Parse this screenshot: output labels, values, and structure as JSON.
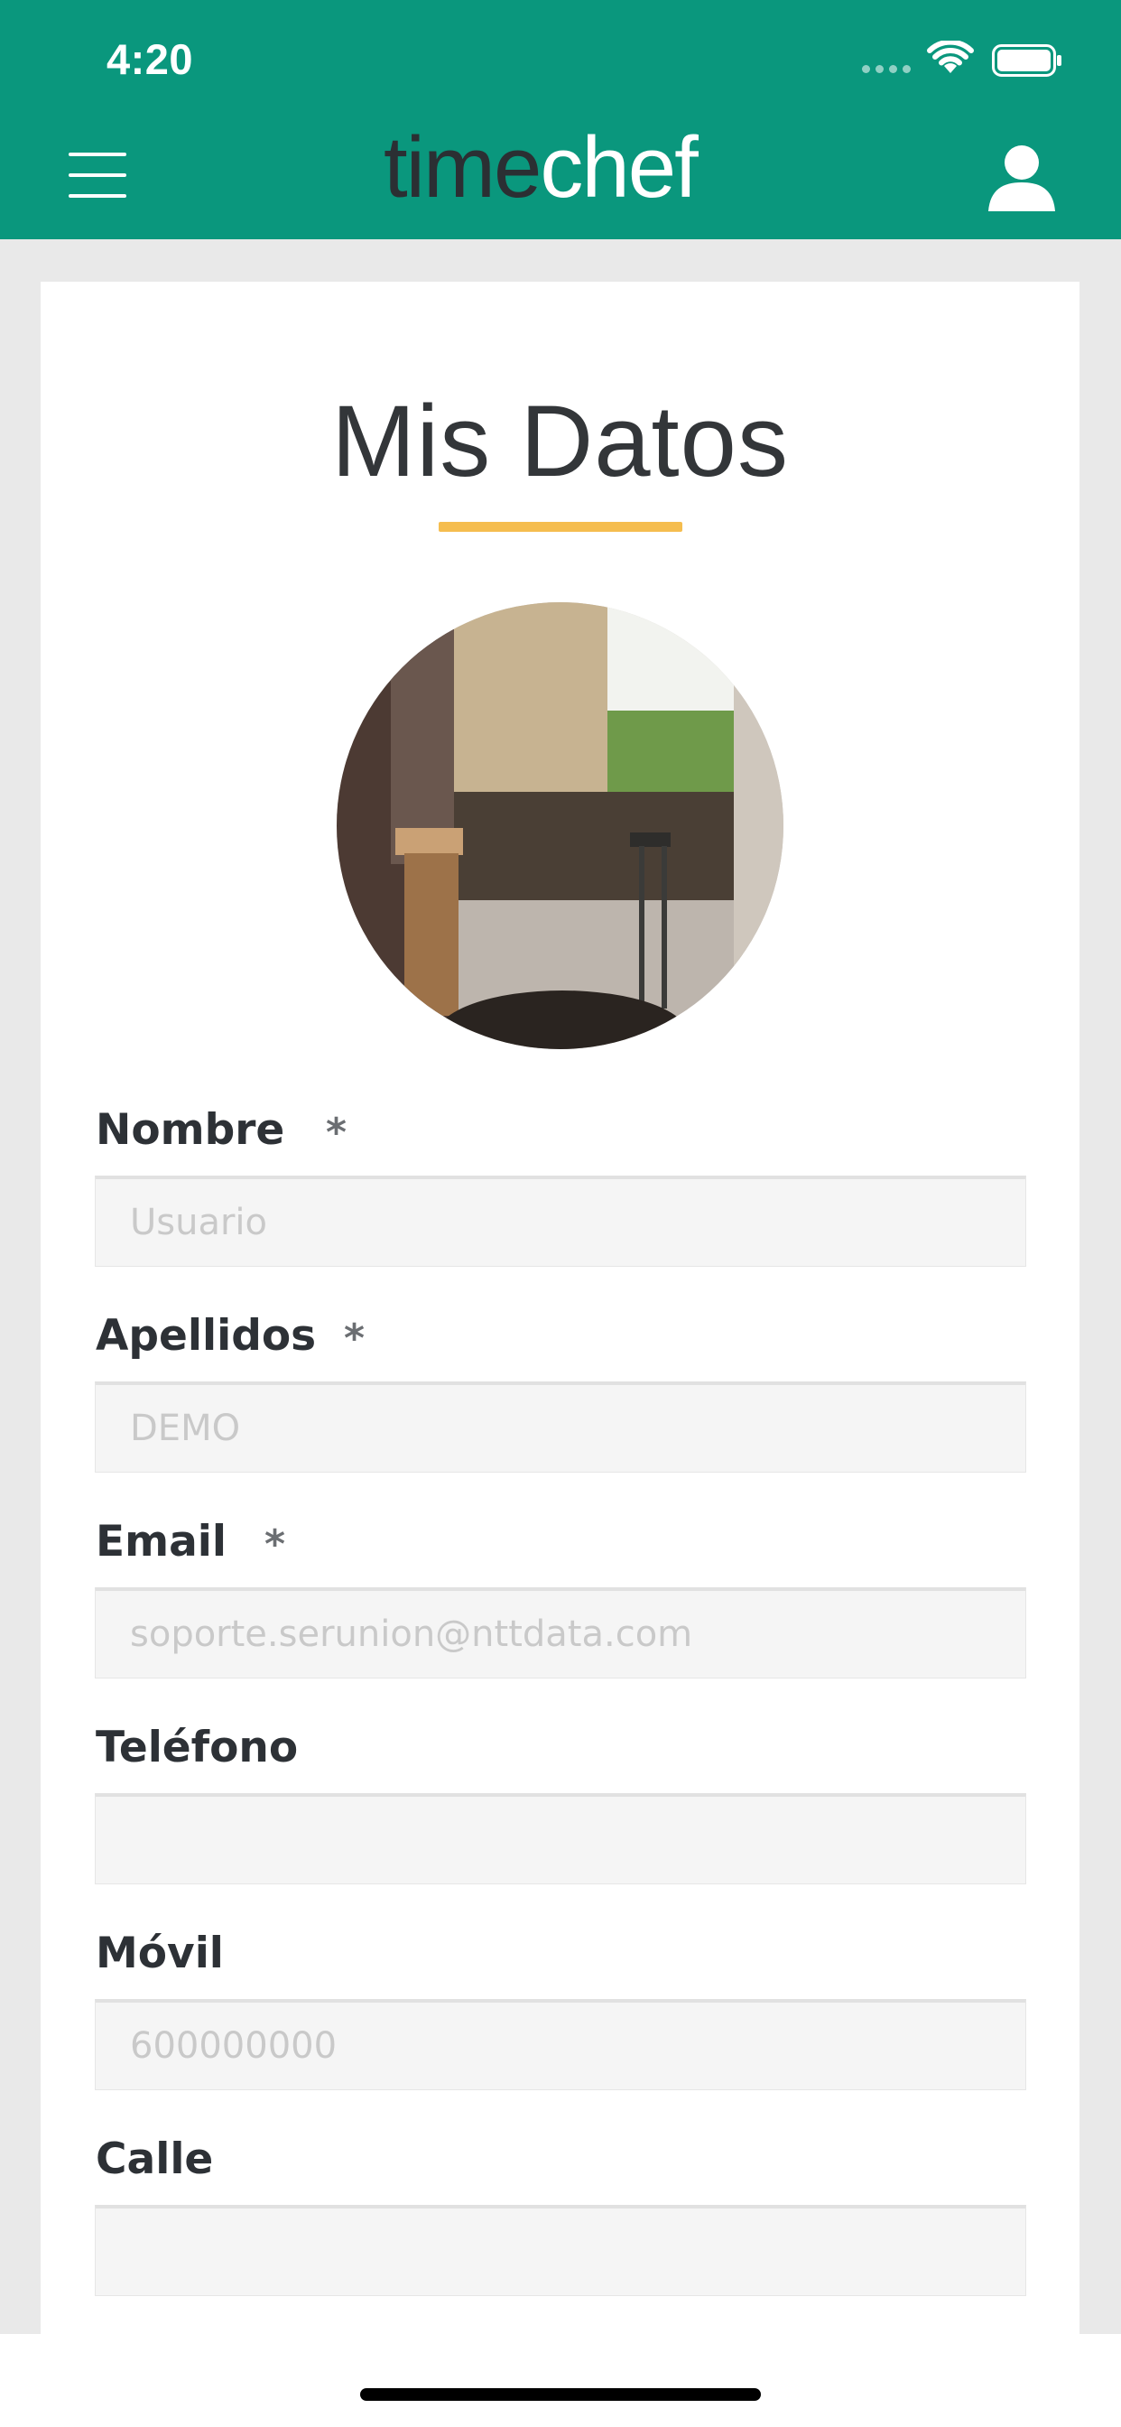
{
  "status_bar": {
    "time": "4:20"
  },
  "header": {
    "logo_part1": "time",
    "logo_part2": "chef",
    "menu_icon": "hamburger-menu-icon",
    "profile_icon": "user-icon",
    "background_color": "#0a977d"
  },
  "page": {
    "title": "Mis Datos",
    "underline_color": "#f5bd4f"
  },
  "form": {
    "fields": [
      {
        "label": "Nombre",
        "required_mark": "*",
        "value": "Usuario"
      },
      {
        "label": "Apellidos",
        "required_mark": "*",
        "value": "DEMO"
      },
      {
        "label": "Email",
        "required_mark": "*",
        "value": "soporte.serunion@nttdata.com"
      },
      {
        "label": "Teléfono",
        "value": ""
      },
      {
        "label": "Móvil",
        "value": "600000000"
      },
      {
        "label": "Calle",
        "value": ""
      }
    ]
  }
}
